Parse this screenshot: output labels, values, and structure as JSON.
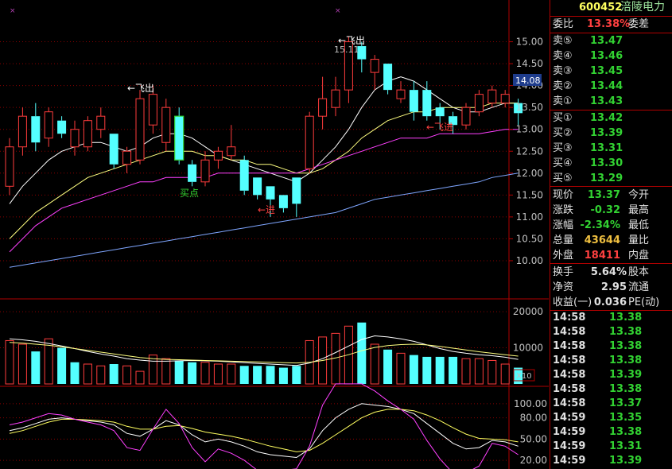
{
  "stock": {
    "code": "600452",
    "name": "涪陵电力"
  },
  "colors": {
    "up": "#ff3c3c",
    "down": "#54ffff",
    "ma5": "#ffffff",
    "ma10": "#ffff80",
    "ma20": "#ff40ff",
    "ma60": "#7fa6ff",
    "grid": "#8b0000"
  },
  "chart_data": [
    {
      "type": "candlestick",
      "title": "",
      "ylim": [
        9.6,
        15.5
      ],
      "y_ticks": [
        "15.00",
        "14.50",
        "14.00",
        "13.50",
        "13.00",
        "12.50",
        "12.00",
        "11.50",
        "11.00",
        "10.50",
        "10.00"
      ],
      "current_price_tag": "14.08",
      "annotations": [
        "←飞出",
        "←飞出",
        "15.11",
        "买点",
        "←进",
        "←飞进"
      ],
      "candles": [
        {
          "o": 11.7,
          "h": 12.8,
          "l": 11.5,
          "c": 12.6
        },
        {
          "o": 12.6,
          "h": 13.5,
          "l": 12.4,
          "c": 13.3
        },
        {
          "o": 13.3,
          "h": 13.6,
          "l": 12.5,
          "c": 12.7
        },
        {
          "o": 12.8,
          "h": 13.5,
          "l": 12.6,
          "c": 13.4
        },
        {
          "o": 13.2,
          "h": 13.3,
          "l": 12.8,
          "c": 12.9
        },
        {
          "o": 12.6,
          "h": 13.2,
          "l": 12.4,
          "c": 13.0
        },
        {
          "o": 12.6,
          "h": 13.3,
          "l": 12.5,
          "c": 13.2
        },
        {
          "o": 13.0,
          "h": 13.5,
          "l": 12.8,
          "c": 13.3
        },
        {
          "o": 12.9,
          "h": 12.9,
          "l": 12.1,
          "c": 12.2
        },
        {
          "o": 12.2,
          "h": 12.6,
          "l": 12.0,
          "c": 12.5
        },
        {
          "o": 12.3,
          "h": 13.9,
          "l": 12.2,
          "c": 13.7
        },
        {
          "o": 13.1,
          "h": 14.0,
          "l": 12.9,
          "c": 13.8
        },
        {
          "o": 12.7,
          "h": 13.7,
          "l": 12.5,
          "c": 13.5
        },
        {
          "o": 13.3,
          "h": 13.5,
          "l": 12.2,
          "c": 12.3
        },
        {
          "o": 12.2,
          "h": 12.3,
          "l": 11.7,
          "c": 11.8
        },
        {
          "o": 11.8,
          "h": 12.5,
          "l": 11.7,
          "c": 12.3
        },
        {
          "o": 12.3,
          "h": 12.6,
          "l": 12.1,
          "c": 12.5
        },
        {
          "o": 12.4,
          "h": 13.1,
          "l": 12.3,
          "c": 12.6
        },
        {
          "o": 12.3,
          "h": 12.4,
          "l": 11.5,
          "c": 11.6
        },
        {
          "o": 11.9,
          "h": 11.9,
          "l": 11.4,
          "c": 11.5
        },
        {
          "o": 11.7,
          "h": 11.7,
          "l": 11.0,
          "c": 11.4
        },
        {
          "o": 11.5,
          "h": 11.5,
          "l": 11.1,
          "c": 11.2
        },
        {
          "o": 11.9,
          "h": 11.9,
          "l": 11.0,
          "c": 11.3
        },
        {
          "o": 12.1,
          "h": 13.4,
          "l": 12.0,
          "c": 13.3
        },
        {
          "o": 13.3,
          "h": 14.2,
          "l": 13.0,
          "c": 13.7
        },
        {
          "o": 13.5,
          "h": 14.2,
          "l": 13.3,
          "c": 13.9
        },
        {
          "o": 13.9,
          "h": 15.11,
          "l": 13.6,
          "c": 15.0
        },
        {
          "o": 14.9,
          "h": 15.0,
          "l": 14.3,
          "c": 14.6
        },
        {
          "o": 14.3,
          "h": 14.7,
          "l": 13.9,
          "c": 14.6
        },
        {
          "o": 14.5,
          "h": 14.5,
          "l": 13.8,
          "c": 13.9
        },
        {
          "o": 13.7,
          "h": 14.1,
          "l": 13.6,
          "c": 13.9
        },
        {
          "o": 13.9,
          "h": 14.1,
          "l": 13.2,
          "c": 13.4
        },
        {
          "o": 13.9,
          "h": 14.1,
          "l": 13.2,
          "c": 13.3
        },
        {
          "o": 13.5,
          "h": 13.6,
          "l": 13.0,
          "c": 13.3
        },
        {
          "o": 13.3,
          "h": 13.4,
          "l": 12.9,
          "c": 13.1
        },
        {
          "o": 13.1,
          "h": 13.6,
          "l": 13.0,
          "c": 13.5
        },
        {
          "o": 13.4,
          "h": 13.9,
          "l": 13.3,
          "c": 13.8
        },
        {
          "o": 13.6,
          "h": 14.0,
          "l": 13.5,
          "c": 13.9
        },
        {
          "o": 13.6,
          "h": 13.9,
          "l": 13.5,
          "c": 13.8
        },
        {
          "o": 13.6,
          "h": 13.7,
          "l": 13.1,
          "c": 13.37
        }
      ],
      "ma_lines": [
        {
          "id": "ma5",
          "values": [
            11.3,
            11.7,
            12.0,
            12.3,
            12.5,
            12.6,
            12.7,
            12.7,
            12.6,
            12.5,
            12.6,
            12.8,
            12.9,
            12.9,
            12.8,
            12.6,
            12.4,
            12.3,
            12.2,
            12.1,
            12.0,
            11.9,
            11.8,
            12.0,
            12.3,
            12.6,
            13.0,
            13.5,
            13.9,
            14.1,
            14.2,
            14.1,
            13.9,
            13.7,
            13.5,
            13.4,
            13.4,
            13.5,
            13.6,
            13.6
          ]
        },
        {
          "id": "ma10",
          "values": [
            10.5,
            10.8,
            11.1,
            11.3,
            11.5,
            11.7,
            11.9,
            12.0,
            12.1,
            12.2,
            12.3,
            12.4,
            12.5,
            12.5,
            12.5,
            12.4,
            12.4,
            12.3,
            12.3,
            12.2,
            12.2,
            12.1,
            12.0,
            12.0,
            12.1,
            12.3,
            12.5,
            12.8,
            13.0,
            13.2,
            13.3,
            13.4,
            13.4,
            13.5,
            13.5,
            13.5,
            13.5,
            13.6,
            13.6,
            13.6
          ]
        },
        {
          "id": "ma20",
          "values": [
            10.2,
            10.5,
            10.8,
            11.0,
            11.2,
            11.3,
            11.4,
            11.5,
            11.6,
            11.7,
            11.8,
            11.8,
            11.9,
            11.9,
            11.9,
            11.9,
            12.0,
            12.0,
            12.0,
            12.0,
            12.0,
            12.0,
            12.0,
            12.1,
            12.2,
            12.3,
            12.4,
            12.5,
            12.6,
            12.7,
            12.8,
            12.8,
            12.8,
            12.9,
            12.9,
            12.9,
            12.9,
            12.95,
            13.0,
            13.0
          ]
        },
        {
          "id": "ma60",
          "values": [
            9.85,
            9.9,
            9.95,
            10.0,
            10.05,
            10.1,
            10.15,
            10.2,
            10.25,
            10.3,
            10.35,
            10.4,
            10.45,
            10.5,
            10.55,
            10.6,
            10.65,
            10.7,
            10.75,
            10.8,
            10.85,
            10.9,
            10.95,
            11.0,
            11.05,
            11.1,
            11.2,
            11.3,
            11.4,
            11.45,
            11.5,
            11.55,
            11.6,
            11.65,
            11.7,
            11.75,
            11.8,
            11.9,
            11.95,
            12.0
          ]
        }
      ]
    },
    {
      "type": "bar",
      "title": "",
      "ylim": [
        0,
        22000
      ],
      "y_ticks": [
        "20000",
        "10000"
      ],
      "scale_label": "X10",
      "values": [
        12000,
        11000,
        9000,
        12500,
        10000,
        6000,
        5500,
        5000,
        5500,
        5000,
        3500,
        8000,
        7000,
        6500,
        6000,
        6000,
        5500,
        5500,
        5000,
        5000,
        5000,
        4500,
        5000,
        12000,
        13000,
        14000,
        16000,
        17000,
        11000,
        9500,
        8500,
        8000,
        7500,
        7500,
        7500,
        7000,
        7000,
        6500,
        5500,
        4500
      ],
      "up": [
        true,
        true,
        false,
        true,
        false,
        false,
        true,
        true,
        false,
        true,
        true,
        true,
        true,
        false,
        false,
        true,
        true,
        true,
        false,
        false,
        false,
        false,
        false,
        true,
        true,
        true,
        true,
        false,
        true,
        false,
        true,
        false,
        false,
        false,
        false,
        true,
        true,
        true,
        true,
        false
      ],
      "ma_lines": [
        {
          "id": "vma1",
          "values": [
            12500,
            12200,
            11800,
            11200,
            10500,
            9800,
            9000,
            8300,
            7700,
            7000,
            6600,
            6300,
            6300,
            6400,
            6500,
            6400,
            6300,
            6100,
            5900,
            5700,
            5500,
            5300,
            5100,
            5800,
            7000,
            8700,
            10500,
            12300,
            13300,
            13000,
            12500,
            11800,
            10800,
            9800,
            9000,
            8500,
            8100,
            7800,
            7400,
            6800
          ]
        },
        {
          "id": "vma2",
          "values": [
            11500,
            11300,
            11000,
            10700,
            10300,
            9800,
            9300,
            8800,
            8300,
            7800,
            7300,
            7000,
            6800,
            6700,
            6600,
            6500,
            6400,
            6300,
            6200,
            6100,
            6000,
            5900,
            5800,
            6000,
            6500,
            7200,
            8100,
            9200,
            10100,
            10600,
            10900,
            11000,
            10800,
            10400,
            9900,
            9400,
            8900,
            8500,
            8100,
            7700
          ]
        }
      ]
    },
    {
      "type": "line",
      "title": "",
      "ylim": [
        10,
        120
      ],
      "y_ticks": [
        "100.00",
        "80.00",
        "50.00",
        "20.00"
      ],
      "series": [
        {
          "id": "k",
          "values": [
            62,
            66,
            72,
            78,
            80,
            78,
            76,
            74,
            70,
            58,
            54,
            64,
            76,
            70,
            56,
            46,
            50,
            46,
            40,
            32,
            28,
            26,
            24,
            36,
            62,
            80,
            92,
            100,
            98,
            96,
            92,
            86,
            72,
            58,
            44,
            36,
            38,
            48,
            46,
            40
          ]
        },
        {
          "id": "d",
          "values": [
            58,
            62,
            68,
            74,
            78,
            78,
            77,
            76,
            74,
            68,
            64,
            64,
            68,
            69,
            65,
            60,
            57,
            54,
            50,
            45,
            40,
            36,
            32,
            34,
            44,
            56,
            68,
            80,
            88,
            92,
            92,
            90,
            84,
            76,
            66,
            57,
            51,
            50,
            49,
            46
          ]
        },
        {
          "id": "j",
          "values": [
            70,
            74,
            80,
            86,
            84,
            78,
            74,
            70,
            62,
            38,
            34,
            64,
            92,
            72,
            38,
            18,
            36,
            30,
            20,
            6,
            4,
            6,
            8,
            40,
            98,
            128,
            140,
            140,
            118,
            104,
            92,
            78,
            48,
            22,
            0,
            0,
            12,
            44,
            40,
            28
          ]
        }
      ]
    }
  ],
  "quote": {
    "header": [
      {
        "label": "委比",
        "value": "13.38%",
        "right": "委差"
      }
    ],
    "sell": [
      {
        "label": "卖⑤",
        "price": "13.47"
      },
      {
        "label": "卖④",
        "price": "13.46"
      },
      {
        "label": "卖③",
        "price": "13.45"
      },
      {
        "label": "卖②",
        "price": "13.44"
      },
      {
        "label": "卖①",
        "price": "13.43"
      }
    ],
    "buy": [
      {
        "label": "买①",
        "price": "13.42"
      },
      {
        "label": "买②",
        "price": "13.39"
      },
      {
        "label": "买③",
        "price": "13.31"
      },
      {
        "label": "买④",
        "price": "13.30"
      },
      {
        "label": "买⑤",
        "price": "13.29"
      }
    ],
    "stats": [
      {
        "label": "现价",
        "value": "13.37",
        "right": "今开",
        "value_color": "t-green"
      },
      {
        "label": "涨跌",
        "value": "-0.32",
        "right": "最高",
        "value_color": "t-green"
      },
      {
        "label": "涨幅",
        "value": "-2.34%",
        "right": "最低",
        "value_color": "t-green"
      },
      {
        "label": "总量",
        "value": "43644",
        "right": "量比",
        "value_color": "t-gold"
      },
      {
        "label": "外盘",
        "value": "18411",
        "right": "内盘",
        "value_color": "t-red"
      }
    ],
    "stats2": [
      {
        "label": "换手",
        "value": "5.64%",
        "right": "股本"
      },
      {
        "label": "净资",
        "value": "2.95",
        "right": "流通"
      },
      {
        "label": "收益(一)",
        "value": "0.036",
        "right": "PE(动)"
      }
    ],
    "ticks": [
      {
        "time": "14:58",
        "price": "13.38"
      },
      {
        "time": "14:58",
        "price": "13.38"
      },
      {
        "time": "14:58",
        "price": "13.38"
      },
      {
        "time": "14:58",
        "price": "13.38"
      },
      {
        "time": "14:58",
        "price": "13.39"
      },
      {
        "time": "14:58",
        "price": "13.38"
      },
      {
        "time": "14:58",
        "price": "13.37"
      },
      {
        "time": "14:59",
        "price": "13.35"
      },
      {
        "time": "14:59",
        "price": "13.38"
      },
      {
        "time": "14:59",
        "price": "13.31"
      },
      {
        "time": "14:59",
        "price": "13.39"
      }
    ]
  }
}
